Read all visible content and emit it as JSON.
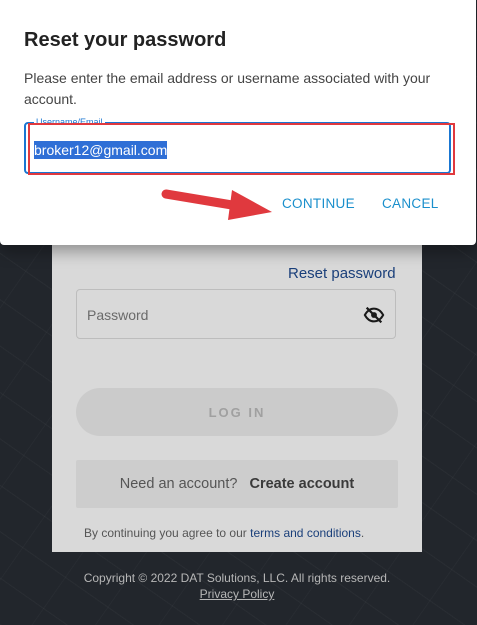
{
  "background": {
    "reset_password_link": "Reset password",
    "password_placeholder": "Password",
    "login_button": "LOG IN",
    "need_account": "Need an account?",
    "create_account": "Create account",
    "terms_prefix": "By continuing you agree to our",
    "terms_link": "terms and conditions",
    "terms_suffix": ".",
    "footer_copyright": "Copyright © 2022 DAT Solutions, LLC. All rights reserved.",
    "footer_privacy": "Privacy Policy"
  },
  "dialog": {
    "title": "Reset your password",
    "message": "Please enter the email address or username associated with your account.",
    "field_label": "Username/Email",
    "field_value": "broker12@gmail.com",
    "continue_label": "CONTINUE",
    "cancel_label": "CANCEL"
  },
  "colors": {
    "accent": "#1976d2",
    "link": "#1a8fcc",
    "annotation": "#e0393e"
  },
  "icons": {
    "password_toggle": "eye-slash-icon",
    "annotation_arrow": "arrow-right-icon"
  }
}
